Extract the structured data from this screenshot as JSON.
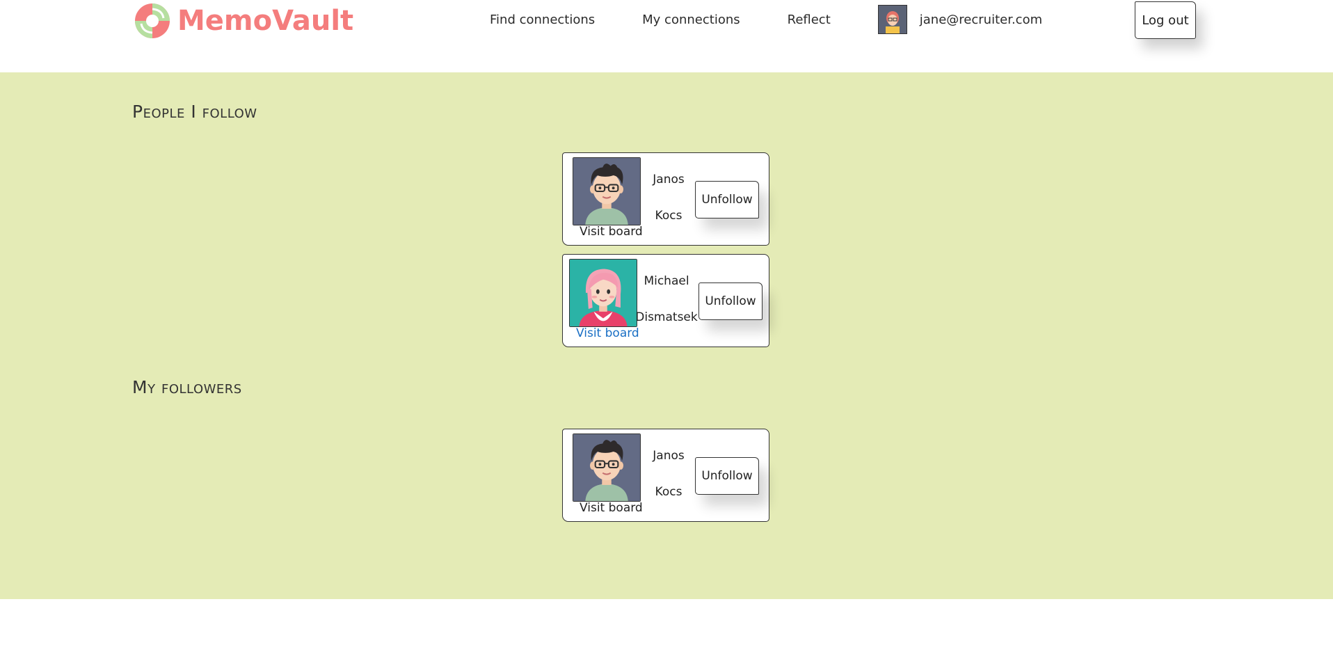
{
  "brand": {
    "name": "MemoVault",
    "color": "#f47d7d",
    "icon": "memovault-logo-icon"
  },
  "nav": {
    "find_connections": "Find connections",
    "my_connections": "My connections",
    "reflect": "Reflect",
    "user_email": "jane@recruiter.com",
    "logout": "Log out"
  },
  "colors": {
    "page_background": "#e4ebb6",
    "link_active": "#1a6fc4"
  },
  "following": {
    "title": "People I follow",
    "people": [
      {
        "first_name": "Janos",
        "last_name": "Kocs",
        "visit_label": "Visit board",
        "action_label": "Unfollow",
        "avatar": "man-with-glasses-avatar"
      },
      {
        "first_name": "Michael",
        "last_name": "Dismatsek",
        "visit_label": "Visit board",
        "action_label": "Unfollow",
        "avatar": "pink-hair-woman-avatar"
      }
    ]
  },
  "followers": {
    "title": "My followers",
    "people": [
      {
        "first_name": "Janos",
        "last_name": "Kocs",
        "visit_label": "Visit board",
        "action_label": "Unfollow",
        "avatar": "man-with-glasses-avatar"
      }
    ]
  }
}
